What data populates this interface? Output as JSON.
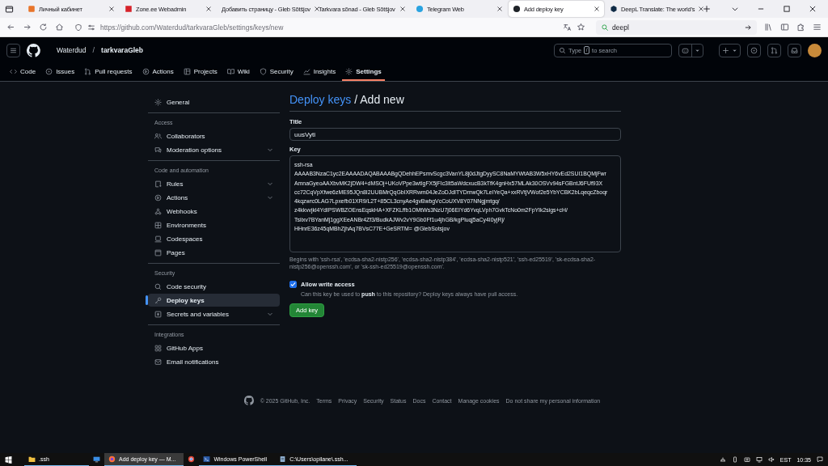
{
  "browser": {
    "tabs": [
      {
        "title": "Личный кабинет",
        "selected": false
      },
      {
        "title": "Zone.ee Webadmin",
        "selected": false
      },
      {
        "title": "Добавить страницу - Gleb Sõtšjov",
        "selected": false
      },
      {
        "title": "Tarkvara sõnad - Gleb Sõtšjov",
        "selected": false
      },
      {
        "title": "Telegram Web",
        "selected": false
      },
      {
        "title": "Add deploy key",
        "selected": true
      },
      {
        "title": "DeepL Translate: The world's",
        "selected": false
      }
    ],
    "address": "https://github.com/Waterdud/tarkvaraGleb/settings/keys/new",
    "search": "deepl"
  },
  "header": {
    "owner": "Waterdud",
    "separator": "/",
    "repo": "tarkvaraGleb",
    "search_parts": [
      "Type",
      "/",
      "to search"
    ]
  },
  "repo_nav": [
    {
      "label": "Code",
      "selected": false
    },
    {
      "label": "Issues",
      "selected": false
    },
    {
      "label": "Pull requests",
      "selected": false
    },
    {
      "label": "Actions",
      "selected": false
    },
    {
      "label": "Projects",
      "selected": false
    },
    {
      "label": "Wiki",
      "selected": false
    },
    {
      "label": "Security",
      "selected": false
    },
    {
      "label": "Insights",
      "selected": false
    },
    {
      "label": "Settings",
      "selected": true
    }
  ],
  "sidebar": {
    "groups": [
      {
        "items": [
          {
            "label": "General",
            "selected": false,
            "collapsible": false
          }
        ]
      },
      {
        "heading": "Access",
        "items": [
          {
            "label": "Collaborators",
            "selected": false,
            "collapsible": false
          },
          {
            "label": "Moderation options",
            "selected": false,
            "collapsible": true
          }
        ]
      },
      {
        "heading": "Code and automation",
        "items": [
          {
            "label": "Rules",
            "selected": false,
            "collapsible": true
          },
          {
            "label": "Actions",
            "selected": false,
            "collapsible": true
          },
          {
            "label": "Webhooks",
            "selected": false,
            "collapsible": false
          },
          {
            "label": "Environments",
            "selected": false,
            "collapsible": false
          },
          {
            "label": "Codespaces",
            "selected": false,
            "collapsible": false
          },
          {
            "label": "Pages",
            "selected": false,
            "collapsible": false
          }
        ]
      },
      {
        "heading": "Security",
        "items": [
          {
            "label": "Code security",
            "selected": false,
            "collapsible": false
          },
          {
            "label": "Deploy keys",
            "selected": true,
            "collapsible": false
          },
          {
            "label": "Secrets and variables",
            "selected": false,
            "collapsible": true
          }
        ]
      },
      {
        "heading": "Integrations",
        "items": [
          {
            "label": "GitHub Apps",
            "selected": false,
            "collapsible": false
          },
          {
            "label": "Email notifications",
            "selected": false,
            "collapsible": false
          }
        ]
      }
    ]
  },
  "form": {
    "heading_link": "Deploy keys",
    "heading_rest": "/ Add new",
    "title_label": "Title",
    "title_value": "uusVyti",
    "key_label": "Key",
    "key_value": "ssh-rsa\nAAAAB3NzaC1yc2EAAAADAQABAAABgQDehhEPsmvScgc3VanYL8j0dJtgDyySC8NaMYWtAB3W5xHY6vEd2SUI1BQMjFwr\nAmnaGyeoAAXbvMK2jDW4+dMSOj+UKoVPpe3wtIgFX5jFIc3It5aWdcxucB3kTfK4gnHx57MLAk30OSVv94sFGBntJ6FUf93X\ncc72CqVpXfwe6zME95JQn8I2UUBMrQqGbIXRRwm04JeZoDJdITYDmwQk7LeIYeQa+xxRVtjVWof2e5YbYCBK2bLqeqcZboqr\n4kqzwrc0LAG7Lpxefb01XR9/L2T+85CL3cnyAe4gvBwbgVcCoUXV8Y07NNgjmtgq/\nz4kkvvjkl4YdIPSWBZOEnsEqskHA+XFZKLffb1OMtWs3NzU7j06EIYd6YvqLVph7GvkTcNo0m2FpYIk2sigs+cH/\nTsiixv7BYanMj1ggXEeANBr4Zf3/BudkAJWv2vY9Gb0Ff1u4jhGB/kgPluqj5aCy4I0yjRj/\nHHnrE36z45qMBhZjhAq7BVsC77E+GeSRTM= @GlebSotsjov",
    "key_hint": "Begins with 'ssh-rsa', 'ecdsa-sha2-nistp256', 'ecdsa-sha2-nistp384', 'ecdsa-sha2-nistp521', 'ssh-ed25519', 'sk-ecdsa-sha2-nistp256@openssh.com', or 'sk-ssh-ed25519@openssh.com'.",
    "write_access": {
      "label": "Allow write access",
      "checked": true,
      "description": "Can this key be used to **push** to this repository? Deploy keys always have pull access."
    },
    "submit": "Add key"
  },
  "footer": {
    "copyright": "© 2025 GitHub, Inc.",
    "links": [
      "Terms",
      "Privacy",
      "Security",
      "Status",
      "Docs",
      "Contact",
      "Manage cookies",
      "Do not share my personal information"
    ]
  },
  "taskbar": {
    "items": [
      {
        "kind": "app",
        "label": ".ssh",
        "selected": false,
        "running": true
      },
      {
        "kind": "icon",
        "selected": false,
        "running": false
      },
      {
        "kind": "app",
        "label": "Add deploy key — M...",
        "selected": true,
        "running": true
      },
      {
        "kind": "icon",
        "selected": false,
        "running": false
      },
      {
        "kind": "app",
        "label": "Windows PowerShell",
        "selected": false,
        "running": true
      },
      {
        "kind": "app",
        "label": "C:\\Users\\opilane\\.ssh...",
        "selected": false,
        "running": true
      }
    ],
    "language": "EST",
    "time": "10:35"
  }
}
